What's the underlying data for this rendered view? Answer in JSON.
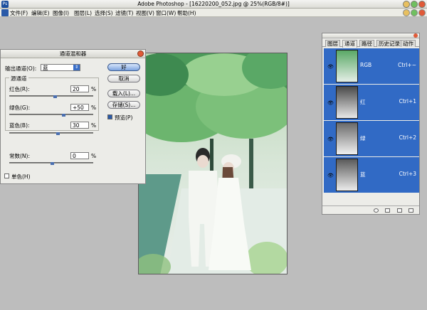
{
  "window": {
    "title": "Adobe Photoshop - [16220200_052.jpg @ 25%(RGB/8#)]"
  },
  "menu": [
    "文件(F)",
    "编辑(E)",
    "图像(I)",
    "图层(L)",
    "选择(S)",
    "滤镜(T)",
    "视图(V)",
    "窗口(W)",
    "帮助(H)"
  ],
  "dialog": {
    "title": "通道混和器",
    "output_label": "输出通道(O):",
    "output_value": "蓝",
    "group_label": "源通道",
    "red_label": "红色(R):",
    "red_value": "20",
    "green_label": "绿色(G):",
    "green_value": "+50",
    "blue_label": "蓝色(B):",
    "blue_value": "30",
    "const_label": "常数(N):",
    "const_value": "0",
    "unit": "%",
    "mono_label": "单色(H)",
    "ok": "好",
    "cancel": "取消",
    "load": "载入(L)...",
    "save": "存储(S)...",
    "preview": "预览(P)"
  },
  "panel": {
    "tabs": [
      "图层",
      "通道",
      "路径",
      "历史记录",
      "动作"
    ],
    "channels": [
      {
        "name": "RGB",
        "shortcut": "Ctrl+~"
      },
      {
        "name": "红",
        "shortcut": "Ctrl+1"
      },
      {
        "name": "绿",
        "shortcut": "Ctrl+2"
      },
      {
        "name": "蓝",
        "shortcut": "Ctrl+3"
      }
    ]
  },
  "colors": {
    "accent": "#316ac5",
    "workspace": "#bdbdbd"
  }
}
